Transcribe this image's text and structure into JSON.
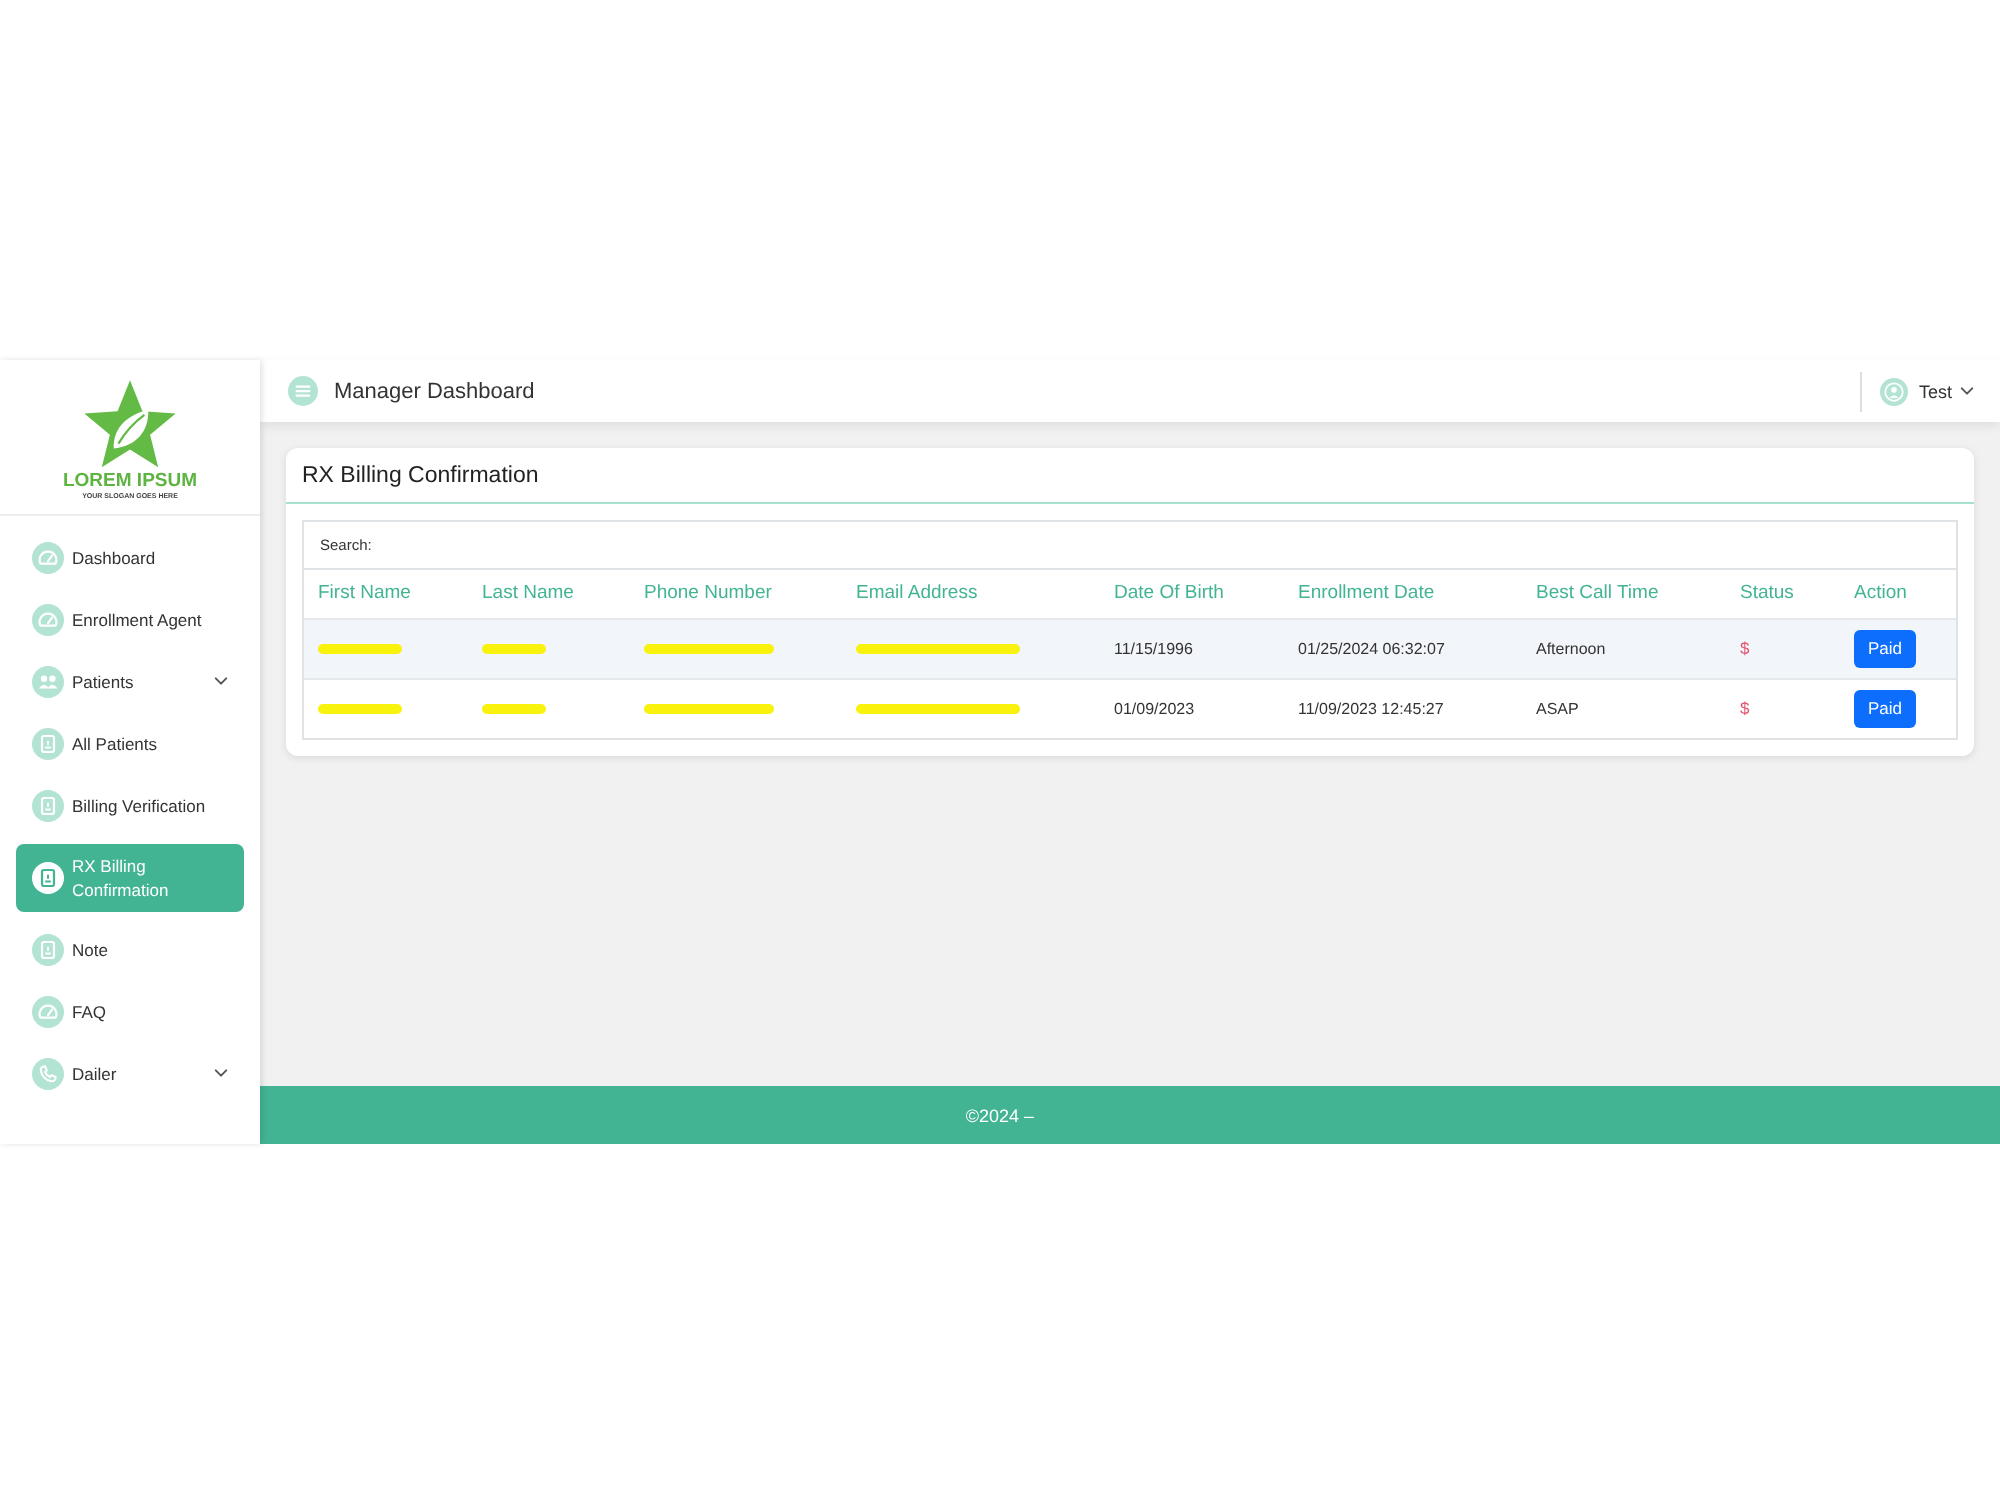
{
  "logo": {
    "name": "LOREM IPSUM",
    "slogan": "YOUR SLOGAN GOES HERE"
  },
  "sidebar": {
    "items": [
      {
        "label": "Dashboard",
        "kind": "link",
        "selected": false
      },
      {
        "label": "Enrollment Agent",
        "kind": "link",
        "selected": false
      },
      {
        "label": "Patients",
        "kind": "group",
        "selected": false
      },
      {
        "label": "All Patients",
        "kind": "link",
        "selected": false
      },
      {
        "label": "Billing Verification",
        "kind": "link",
        "selected": false
      },
      {
        "label": "RX Billing Confirmation",
        "kind": "link",
        "selected": true
      },
      {
        "label": "Note",
        "kind": "link",
        "selected": false
      },
      {
        "label": "FAQ",
        "kind": "link",
        "selected": false
      },
      {
        "label": "Dailer",
        "kind": "group",
        "selected": false
      }
    ]
  },
  "header": {
    "title": "Manager Dashboard",
    "user": "Test"
  },
  "card": {
    "title": "RX Billing Confirmation",
    "search_label": "Search:",
    "table": {
      "columns": [
        "First Name",
        "Last Name",
        "Phone Number",
        "Email Address",
        "Date Of Birth",
        "Enrollment Date",
        "Best Call Time",
        "Status",
        "Action"
      ],
      "rows": [
        {
          "cells": [
            {
              "kind": "redacted"
            },
            {
              "kind": "redacted"
            },
            {
              "kind": "redacted"
            },
            {
              "kind": "redacted"
            },
            {
              "kind": "text",
              "text": "11/15/1996"
            },
            {
              "kind": "text",
              "text": "01/25/2024 06:32:07"
            },
            {
              "kind": "text",
              "text": "Afternoon"
            },
            {
              "kind": "status",
              "text": "$"
            },
            {
              "kind": "button",
              "text": "Paid"
            }
          ]
        },
        {
          "cells": [
            {
              "kind": "redacted"
            },
            {
              "kind": "redacted"
            },
            {
              "kind": "redacted"
            },
            {
              "kind": "redacted"
            },
            {
              "kind": "text",
              "text": "01/09/2023"
            },
            {
              "kind": "text",
              "text": "11/09/2023 12:45:27"
            },
            {
              "kind": "text",
              "text": "ASAP"
            },
            {
              "kind": "status",
              "text": "$"
            },
            {
              "kind": "button",
              "text": "Paid"
            }
          ]
        }
      ]
    }
  },
  "footer": {
    "text": "©2024 –"
  }
}
